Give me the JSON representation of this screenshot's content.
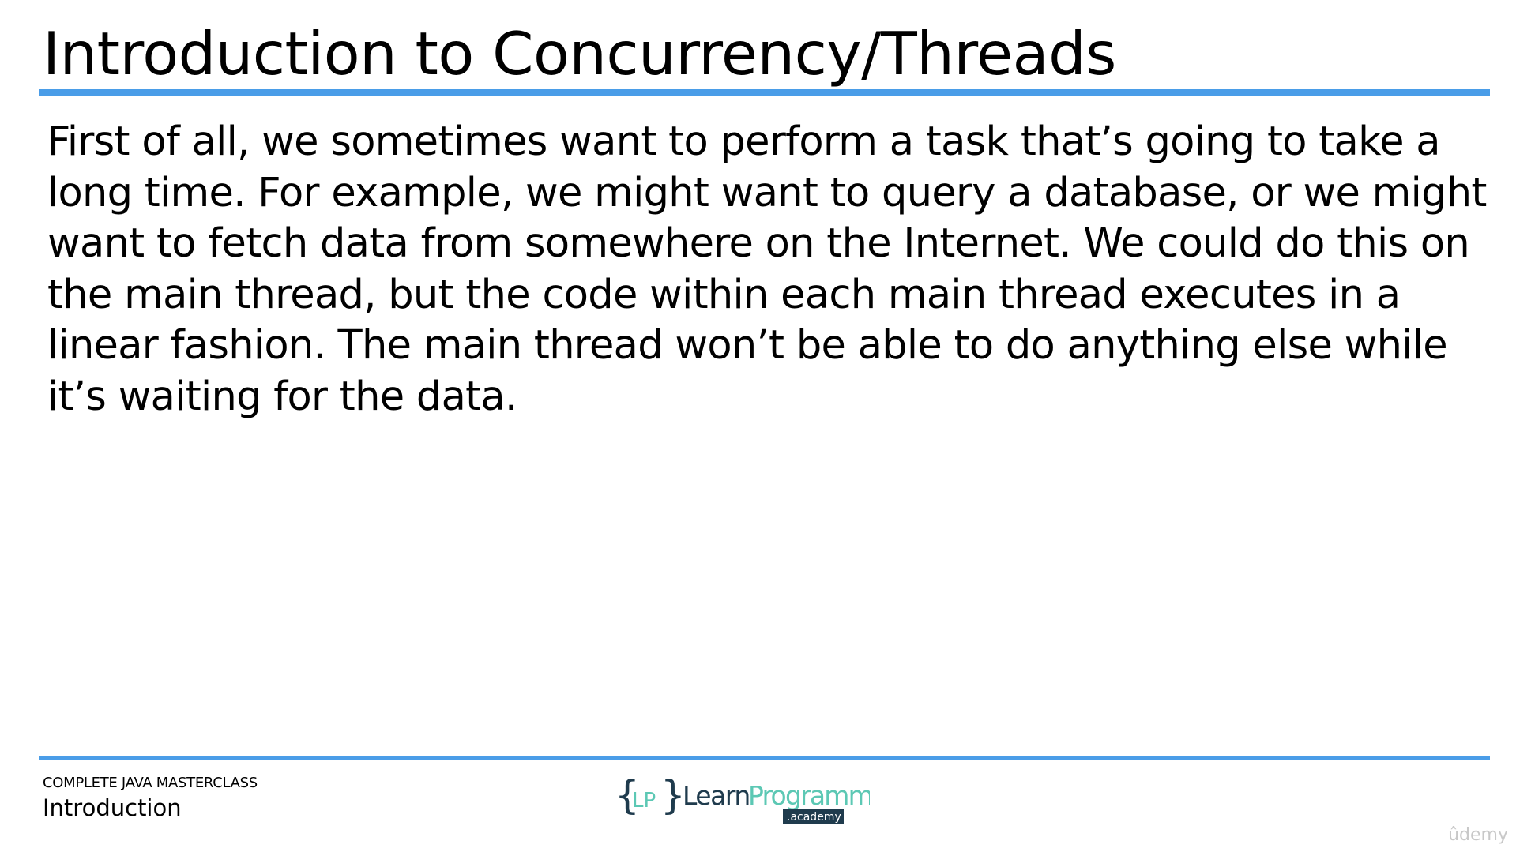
{
  "slide": {
    "title": "Introduction to Concurrency/Threads",
    "body_lines": [
      "First of all, we sometimes want to perform a task that’s going to take a",
      "long time. For example, we might want to query a database, or we might",
      "want to fetch data from somewhere on the Internet. We could do this on",
      "the main thread, but the code within each main thread executes in a",
      "linear fashion. The main thread won’t be able to do anything else while",
      "it’s waiting for the data."
    ]
  },
  "footer": {
    "course": "COMPLETE JAVA MASTERCLASS",
    "section": "Introduction",
    "logo": {
      "open_brace": "{",
      "initials": "LP",
      "close_brace": "}",
      "word_learn": "Learn",
      "word_programming": "Programming",
      "badge": ".academy"
    },
    "brand": "ûdemy"
  },
  "colors": {
    "accent": "#4a9de8",
    "logo_green": "#5cc8b4",
    "logo_dark": "#1f3b4d",
    "text": "#000000"
  }
}
